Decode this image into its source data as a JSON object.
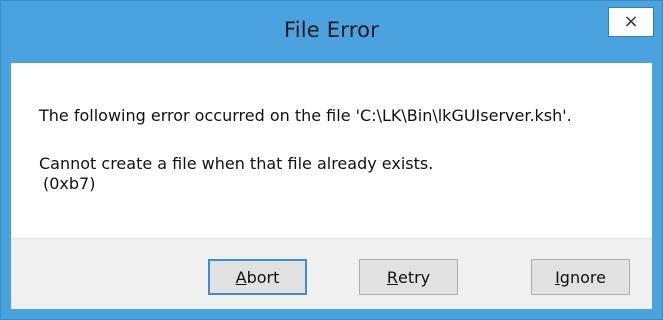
{
  "window": {
    "title": "File Error",
    "close_glyph": "×"
  },
  "message": {
    "line1": "The following error occurred on the file 'C:\\LK\\Bin\\lkGUIserver.ksh'.",
    "line2": "Cannot create a file when that file already exists.",
    "line3": "(0xb7)"
  },
  "buttons": {
    "abort": {
      "mnemonic": "A",
      "rest": "bort"
    },
    "retry": {
      "mnemonic": "R",
      "rest": "etry"
    },
    "ignore": {
      "mnemonic": "I",
      "rest": "gnore"
    }
  },
  "colors": {
    "titlebar": "#4aa3df",
    "button_face": "#e1e1e1",
    "default_border": "#3c8fd6",
    "button_bar": "#f0f0f0"
  },
  "icons": {
    "close": "close-icon"
  }
}
